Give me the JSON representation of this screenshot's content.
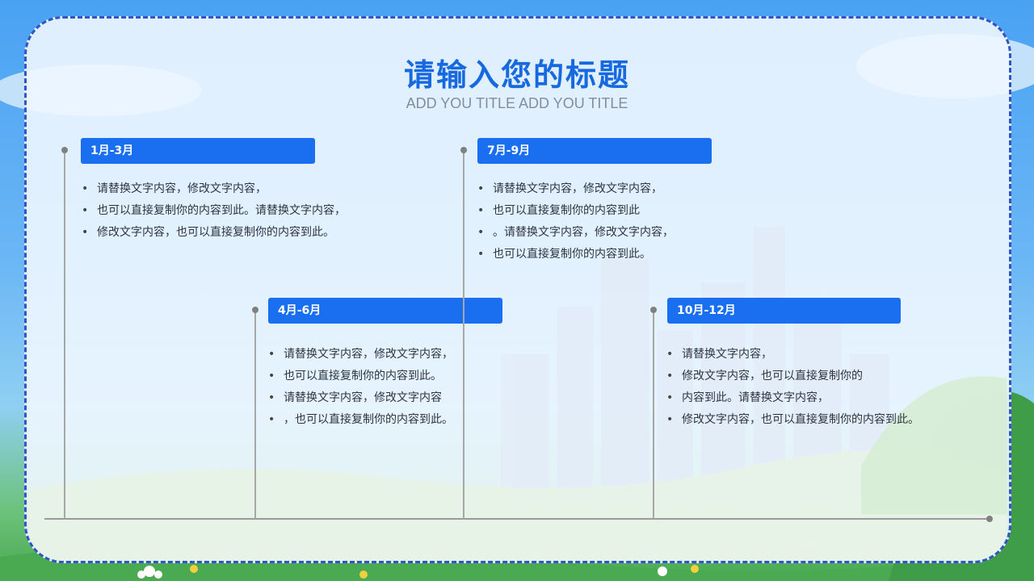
{
  "header": {
    "title": "请输入您的标题",
    "subtitle": "ADD YOU TITLE   ADD YOU TITLE"
  },
  "timeline": [
    {
      "period": "1月-3月",
      "items": [
        "请替换文字内容，修改文字内容，",
        "也可以直接复制你的内容到此。请替换文字内容，",
        "修改文字内容，也可以直接复制你的内容到此。"
      ]
    },
    {
      "period": "4月-6月",
      "items": [
        "请替换文字内容，修改文字内容，",
        "也可以直接复制你的内容到此。",
        "请替换文字内容，修改文字内容",
        "，也可以直接复制你的内容到此。"
      ]
    },
    {
      "period": "7月-9月",
      "items": [
        "请替换文字内容，修改文字内容，",
        "也可以直接复制你的内容到此",
        "。请替换文字内容，修改文字内容，",
        "也可以直接复制你的内容到此。"
      ]
    },
    {
      "period": "10月-12月",
      "items": [
        "请替换文字内容，",
        "修改文字内容，也可以直接复制你的",
        "内容到此。请替换文字内容，",
        "修改文字内容，也可以直接复制你的内容到此。"
      ]
    }
  ],
  "colors": {
    "accent": "#1a6ff0",
    "title": "#1769e0",
    "frame_border": "#2f55c9",
    "axis": "#9a9a9a"
  }
}
